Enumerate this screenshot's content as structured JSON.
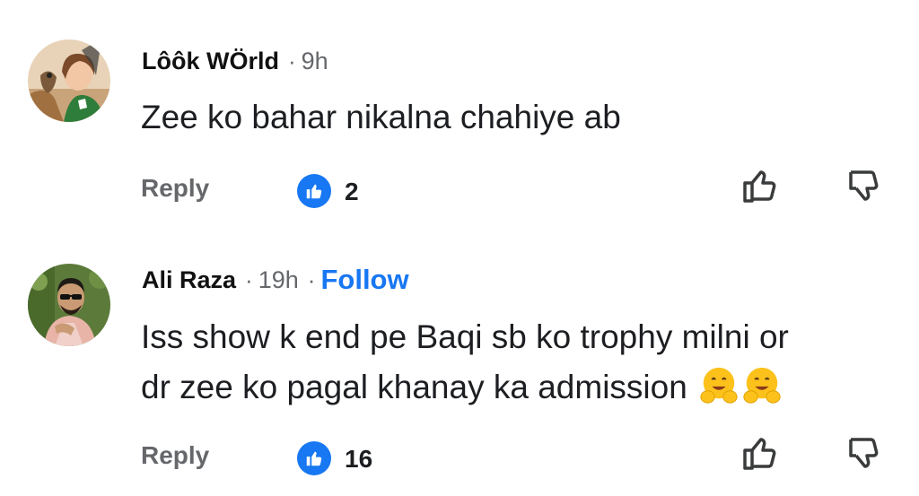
{
  "comments": [
    {
      "author": "Lôôk WÖrld",
      "separator": "·",
      "time": "9h",
      "text": "Zee ko bahar nikalna chahiye ab",
      "reply_label": "Reply",
      "like_count": "2",
      "avatar_icon": "avatar-girl-with-falcon"
    },
    {
      "author": "Ali Raza",
      "separator": "·",
      "time": "19h",
      "follow_label": "Follow",
      "text_line1": "Iss show k end pe Baqi sb ko trophy milni or",
      "text_line2": "dr zee ko pagal khanay ka admission",
      "emojis": [
        "hugging-face-emoji",
        "hugging-face-emoji"
      ],
      "reply_label": "Reply",
      "like_count": "16",
      "avatar_icon": "avatar-man-sunglasses"
    }
  ],
  "colors": {
    "like_blue": "#1877f2",
    "meta_gray": "#65676b",
    "text": "#1c1e21"
  }
}
